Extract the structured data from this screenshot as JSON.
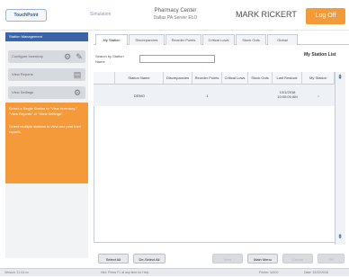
{
  "header": {
    "logo_text": "TouchPoint",
    "app_label": "Simulation",
    "center_line1": "Pharmacy Center",
    "center_line2": "Dallas PA Server ELO",
    "user_name": "MARK RICKERT",
    "logoff_label": "Log Off"
  },
  "sidebar": {
    "title": "Station Management",
    "items": [
      {
        "label": "Configure Inventory",
        "icon": "gear-icon"
      },
      {
        "label": "View Reports",
        "icon": "report-icon"
      },
      {
        "label": "View Settings",
        "icon": "settings-icon"
      }
    ],
    "help_text_1": "Select a Single Station to \"View Inventory,\" \"View Reports\" or \"View Settings\".",
    "help_text_2": "Select multiple stations to view and print their reports."
  },
  "tabs": [
    {
      "label": "My Station",
      "active": true
    },
    {
      "label": "Discrepancies",
      "active": false
    },
    {
      "label": "Reorder Points",
      "active": false
    },
    {
      "label": "Critical Lows",
      "active": false
    },
    {
      "label": "Stock Outs",
      "active": false
    },
    {
      "label": "Global",
      "active": false
    }
  ],
  "search": {
    "label": "Search by Station Name",
    "value": ""
  },
  "list_title": "My Station List",
  "table": {
    "columns": [
      "",
      "Station Name",
      "Discrepancies",
      "Reorder Points",
      "Critical Lows",
      "Stock Outs",
      "Last Restock",
      "My Station"
    ],
    "rows": [
      {
        "check": "",
        "station_name": "DEMO",
        "discrepancies": "",
        "reorder_points": "1",
        "critical_lows": "",
        "stock_outs": "",
        "last_restock": "10/1/2018 10:00:00 AM",
        "my_station": "x"
      }
    ]
  },
  "buttons": {
    "select_all": "Select All",
    "deselect_all": "De-Select All",
    "view": "View",
    "main_menu": "Main Menu",
    "cancel": "Cancel",
    "ok": "OK"
  },
  "status": {
    "version": "Version: 11.04.xx",
    "hint": "Hint: Press F1 at any time for Help",
    "printer": "Printer: W100",
    "date": "Date: 10/22/2018"
  }
}
